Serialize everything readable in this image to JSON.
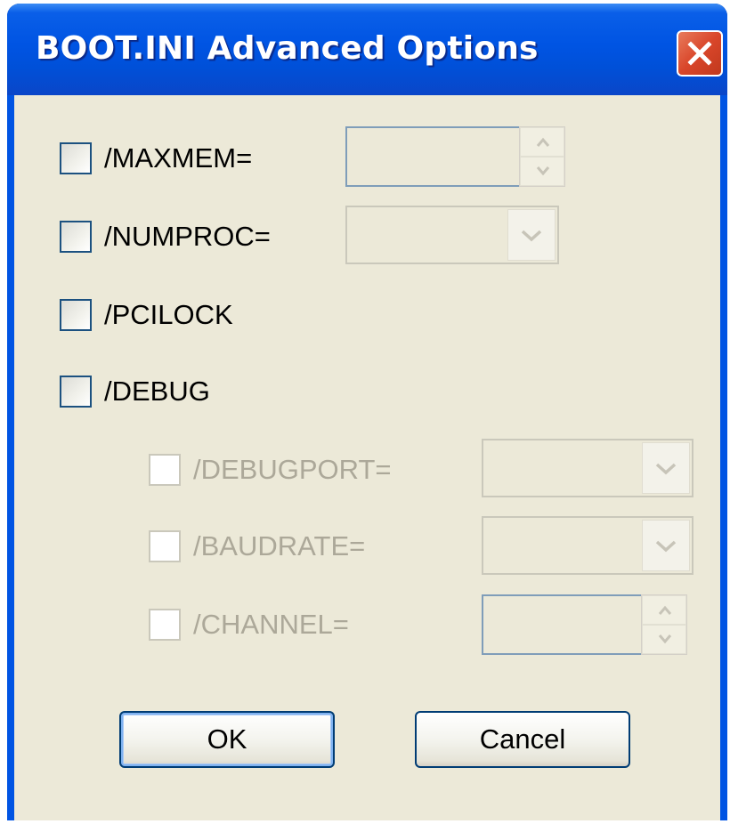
{
  "window": {
    "title": "BOOT.INI Advanced Options",
    "close_icon": "close-icon"
  },
  "options": [
    {
      "label": "/MAXMEM=",
      "checked": false,
      "enabled": true,
      "control": "spinner",
      "value": ""
    },
    {
      "label": "/NUMPROC=",
      "checked": false,
      "enabled": true,
      "control": "dropdown",
      "value": ""
    },
    {
      "label": "/PCILOCK",
      "checked": false,
      "enabled": true
    },
    {
      "label": "/DEBUG",
      "checked": false,
      "enabled": true
    }
  ],
  "debug_options": [
    {
      "label": "/DEBUGPORT=",
      "checked": false,
      "enabled": false,
      "control": "dropdown",
      "value": ""
    },
    {
      "label": "/BAUDRATE=",
      "checked": false,
      "enabled": false,
      "control": "dropdown",
      "value": ""
    },
    {
      "label": "/CHANNEL=",
      "checked": false,
      "enabled": false,
      "control": "spinner",
      "value": ""
    }
  ],
  "buttons": {
    "ok": "OK",
    "cancel": "Cancel"
  },
  "colors": {
    "title_bar": "#0054e3",
    "close_button": "#d9462a",
    "dialog_background": "#ece9d8",
    "disabled_text": "#aca899"
  }
}
